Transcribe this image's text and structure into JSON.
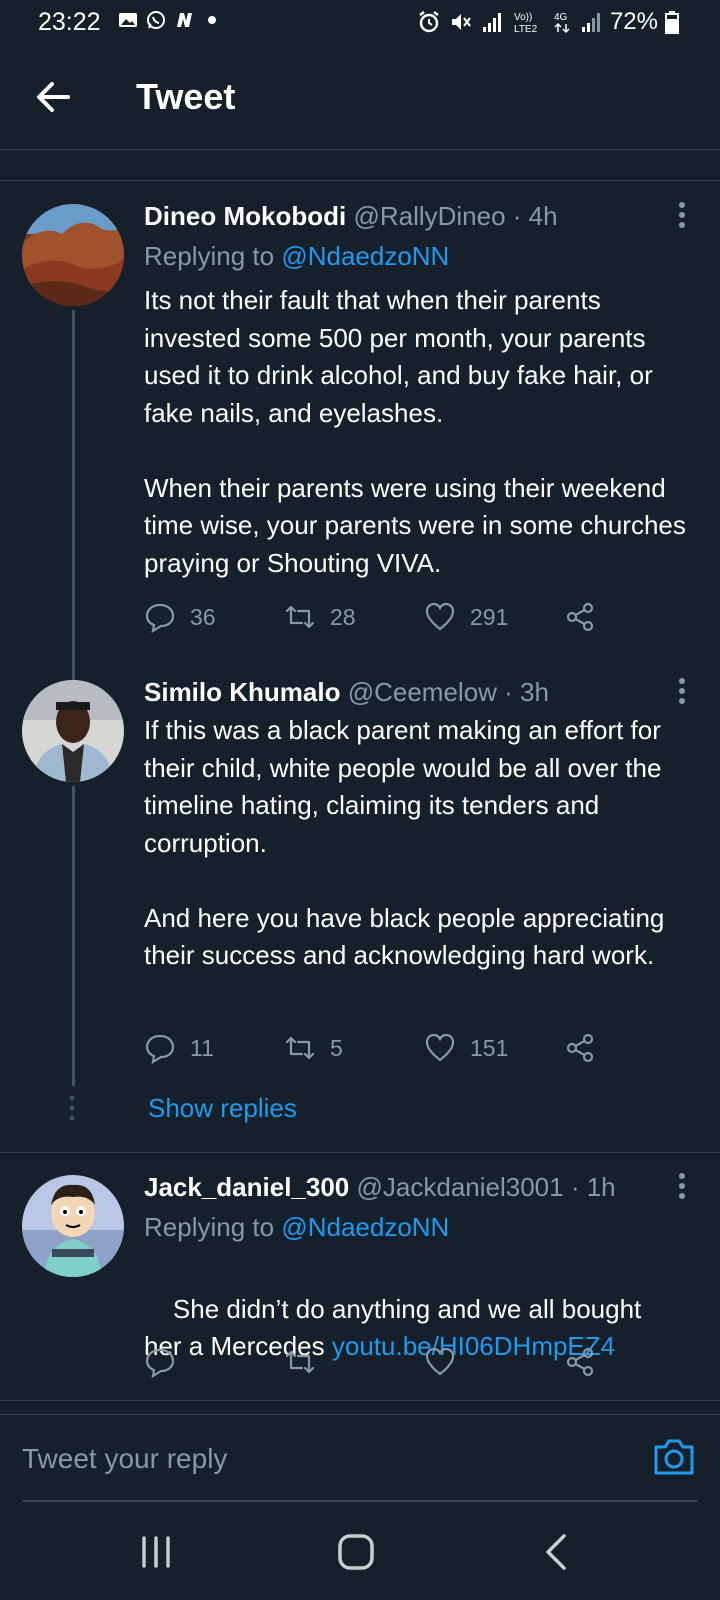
{
  "status_bar": {
    "time": "23:22",
    "battery": "72%",
    "left_icons": [
      "gallery-icon",
      "whatsapp-icon",
      "n-app-icon",
      "dot-icon"
    ],
    "right_icons": [
      "alarm-icon",
      "mute-icon",
      "signal-icon",
      "volte-icon",
      "4g-icon",
      "signal-icon-2",
      "battery-icon"
    ]
  },
  "header": {
    "title": "Tweet"
  },
  "tweets": [
    {
      "name": "Dineo Mokobodi",
      "handle": "@RallyDineo",
      "time": " · 4h",
      "replying_label": "Replying to ",
      "replying_to": "@NdaedzoNN",
      "text": "Its not their fault that when their parents invested some 500 per month, your parents used it to drink alcohol, and buy fake hair, or fake nails, and eyelashes.\n\nWhen their parents were using their weekend time wise, your parents were in some churches praying or Shouting VIVA.",
      "replies": "36",
      "retweets": "28",
      "likes": "291"
    },
    {
      "name": "Similo Khumalo",
      "handle": "@Ceemelow",
      "time": " · 3h",
      "text": "If this was a black parent making an effort for their child, white people would be all over the timeline hating, claiming its tenders and corruption.\n\nAnd here you have black people appreciating their success and acknowledging hard work.",
      "replies": "11",
      "retweets": "5",
      "likes": "151"
    },
    {
      "name": "Jack_daniel_300",
      "handle": "@Jackdaniel3001",
      "time": " · 1h",
      "replying_label": "Replying to ",
      "replying_to": "@NdaedzoNN",
      "text_line1": "She didn’t do anything and we all bought",
      "text_line2": "her a Mercedes ",
      "link": "youtu.be/HI06DHmpEZ4"
    }
  ],
  "show_replies": "Show replies",
  "reply_bar": {
    "placeholder": "Tweet your reply"
  },
  "colors": {
    "background": "#15202b",
    "accent": "#1d9bf0",
    "muted": "#8899a6",
    "divider": "#38444d"
  }
}
